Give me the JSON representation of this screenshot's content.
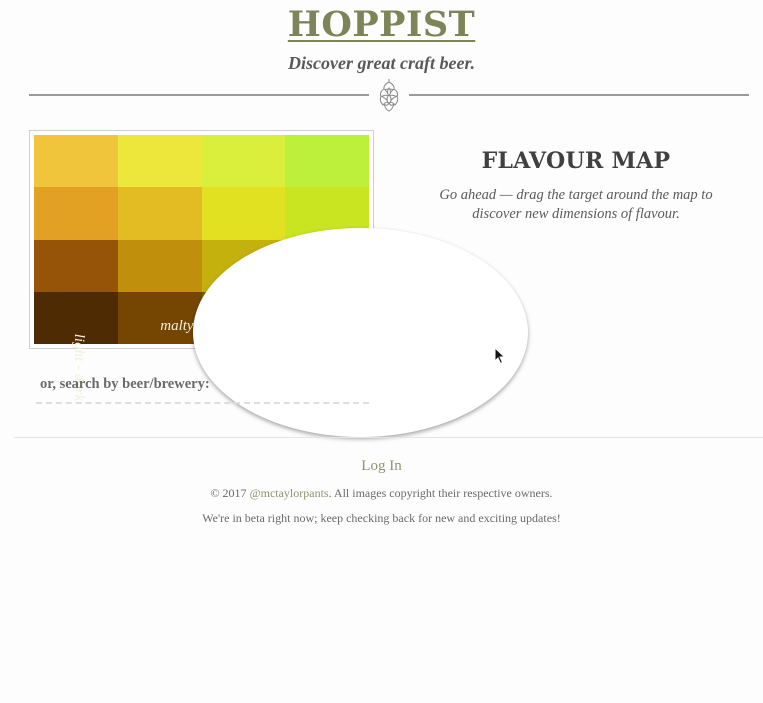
{
  "header": {
    "brand": "HOPPIST",
    "tagline": "Discover great craft beer."
  },
  "icons": {
    "divider": "hop-cone-icon",
    "cursor": "mouse-pointer-icon"
  },
  "flavour_map": {
    "axis_x_label": "malty - hoppy",
    "axis_y_label": "light - dark",
    "target_position": {
      "hoppy": 0.515,
      "dark": 0.51
    },
    "colors": [
      [
        "#f0c53b",
        "#ede63b",
        "#d9ef3c",
        "#bdf03a"
      ],
      [
        "#e3a124",
        "#e3bc24",
        "#e1e021",
        "#c9e421"
      ],
      [
        "#965409",
        "#c08f0c",
        "#c5b10d",
        "#b8c311"
      ],
      [
        "#4e2b02",
        "#744602",
        "#6f6502",
        "#6d6d02"
      ]
    ],
    "title": "FLAVOUR MAP",
    "description": "Go ahead — drag the target around the map to discover new dimensions of flavour."
  },
  "search": {
    "label": "or, search by beer/brewery:",
    "value": "",
    "placeholder": ""
  },
  "footer": {
    "login_label": "Log In",
    "copyright_prefix": "© 2017 ",
    "copyright_handle": "@mctaylorpants",
    "copyright_suffix": ". All images copyright their respective owners.",
    "beta_notice": "We're in beta right now; keep checking back for new and exciting updates!"
  }
}
